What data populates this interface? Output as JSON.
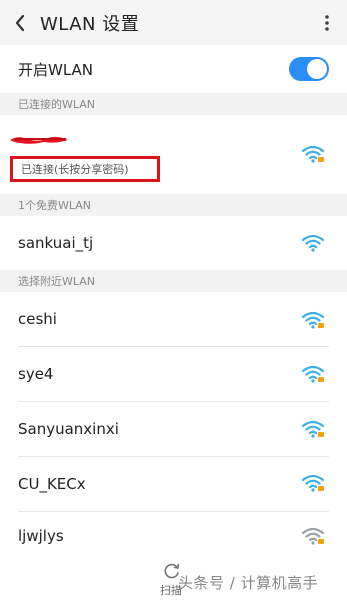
{
  "header": {
    "title": "WLAN 设置",
    "back_icon": "chevron-left-icon",
    "more_icon": "more-vertical-icon"
  },
  "toggle": {
    "label": "开启WLAN",
    "state": "on",
    "color": "#2a8ff5"
  },
  "sections": {
    "connected": "已连接的WLAN",
    "free": "1个免费WLAN",
    "nearby": "选择附近WLAN"
  },
  "connected_network": {
    "status": "已连接(长按分享密码)",
    "signal": "strong-locked"
  },
  "free_networks": [
    {
      "name": "sankuai_tj",
      "signal": "strong"
    }
  ],
  "nearby_networks": [
    {
      "name": "ceshi",
      "signal": "strong-locked"
    },
    {
      "name": "sye4",
      "signal": "strong-locked"
    },
    {
      "name": "Sanyuanxinxi",
      "signal": "strong-locked"
    },
    {
      "name": "CU_KECx",
      "signal": "strong-locked"
    },
    {
      "name": "ljwjlys",
      "signal": "weak-locked"
    }
  ],
  "footer": {
    "scan_label": "扫描",
    "watermark": "头条号 / 计算机高手"
  },
  "colors": {
    "wifi_strong": "#3cb0e6",
    "wifi_weak": "#9aa0a6",
    "lock": "#f2a20d",
    "highlight_box": "#d8141c"
  }
}
